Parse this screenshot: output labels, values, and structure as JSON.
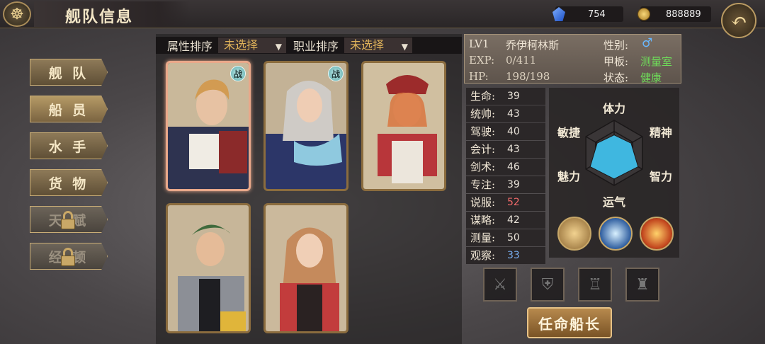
{
  "header": {
    "title": "舰队信息",
    "gems": "754",
    "gold": "888889",
    "emblem_icon": "ship-wheel-icon",
    "back_icon": "back-arrow-icon"
  },
  "sidebar": {
    "items": [
      {
        "label": "舰 队",
        "locked": false
      },
      {
        "label": "船 员",
        "locked": false,
        "active": true
      },
      {
        "label": "水 手",
        "locked": false
      },
      {
        "label": "货 物",
        "locked": false
      },
      {
        "label": "天 赋",
        "locked": true
      },
      {
        "label": "经 顿",
        "locked": true
      }
    ]
  },
  "sort": {
    "attr_label": "属性排序",
    "attr_value": "未选择",
    "job_label": "职业排序",
    "job_value": "未选择"
  },
  "crew": [
    {
      "name": "card-1",
      "badge": "战",
      "selected": true
    },
    {
      "name": "card-2",
      "badge": "战",
      "selected": false
    },
    {
      "name": "card-3",
      "badge": "",
      "selected": false
    },
    {
      "name": "card-4",
      "badge": "",
      "selected": false
    },
    {
      "name": "card-5",
      "badge": "",
      "selected": false
    }
  ],
  "character": {
    "level": "LV1",
    "name": "乔伊柯林斯",
    "exp_label": "EXP:",
    "exp": "0/411",
    "hp_label": "HP:",
    "hp": "198/198",
    "gender_label": "性别:",
    "gender_icon": "male-icon",
    "gender_glyph": "♂",
    "deck_label": "甲板:",
    "deck": "测量室",
    "status_label": "状态:",
    "status": "健康"
  },
  "stats": [
    {
      "name": "生命:",
      "value": "39",
      "tone": ""
    },
    {
      "name": "统帅:",
      "value": "43",
      "tone": ""
    },
    {
      "name": "驾驶:",
      "value": "40",
      "tone": ""
    },
    {
      "name": "会计:",
      "value": "43",
      "tone": ""
    },
    {
      "name": "剑术:",
      "value": "46",
      "tone": ""
    },
    {
      "name": "专注:",
      "value": "39",
      "tone": ""
    },
    {
      "name": "说服:",
      "value": "52",
      "tone": "red"
    },
    {
      "name": "谋略:",
      "value": "42",
      "tone": ""
    },
    {
      "name": "测量:",
      "value": "50",
      "tone": ""
    },
    {
      "name": "观察:",
      "value": "33",
      "tone": "blue"
    }
  ],
  "radar": {
    "labels": [
      "体力",
      "精神",
      "智力",
      "运气",
      "魅力",
      "敏捷"
    ],
    "values": [
      0.55,
      0.6,
      0.85,
      0.8,
      0.85,
      0.6
    ],
    "fill_color": "#3fb7e0"
  },
  "skills": [
    "crate-skill-icon",
    "wind-skill-icon",
    "fire-skill-icon"
  ],
  "equipment": [
    "sword-slot-icon",
    "armor-slot-icon",
    "cup-slot-icon",
    "goblet-slot-icon"
  ],
  "actions": {
    "appoint_label": "任命船长"
  }
}
